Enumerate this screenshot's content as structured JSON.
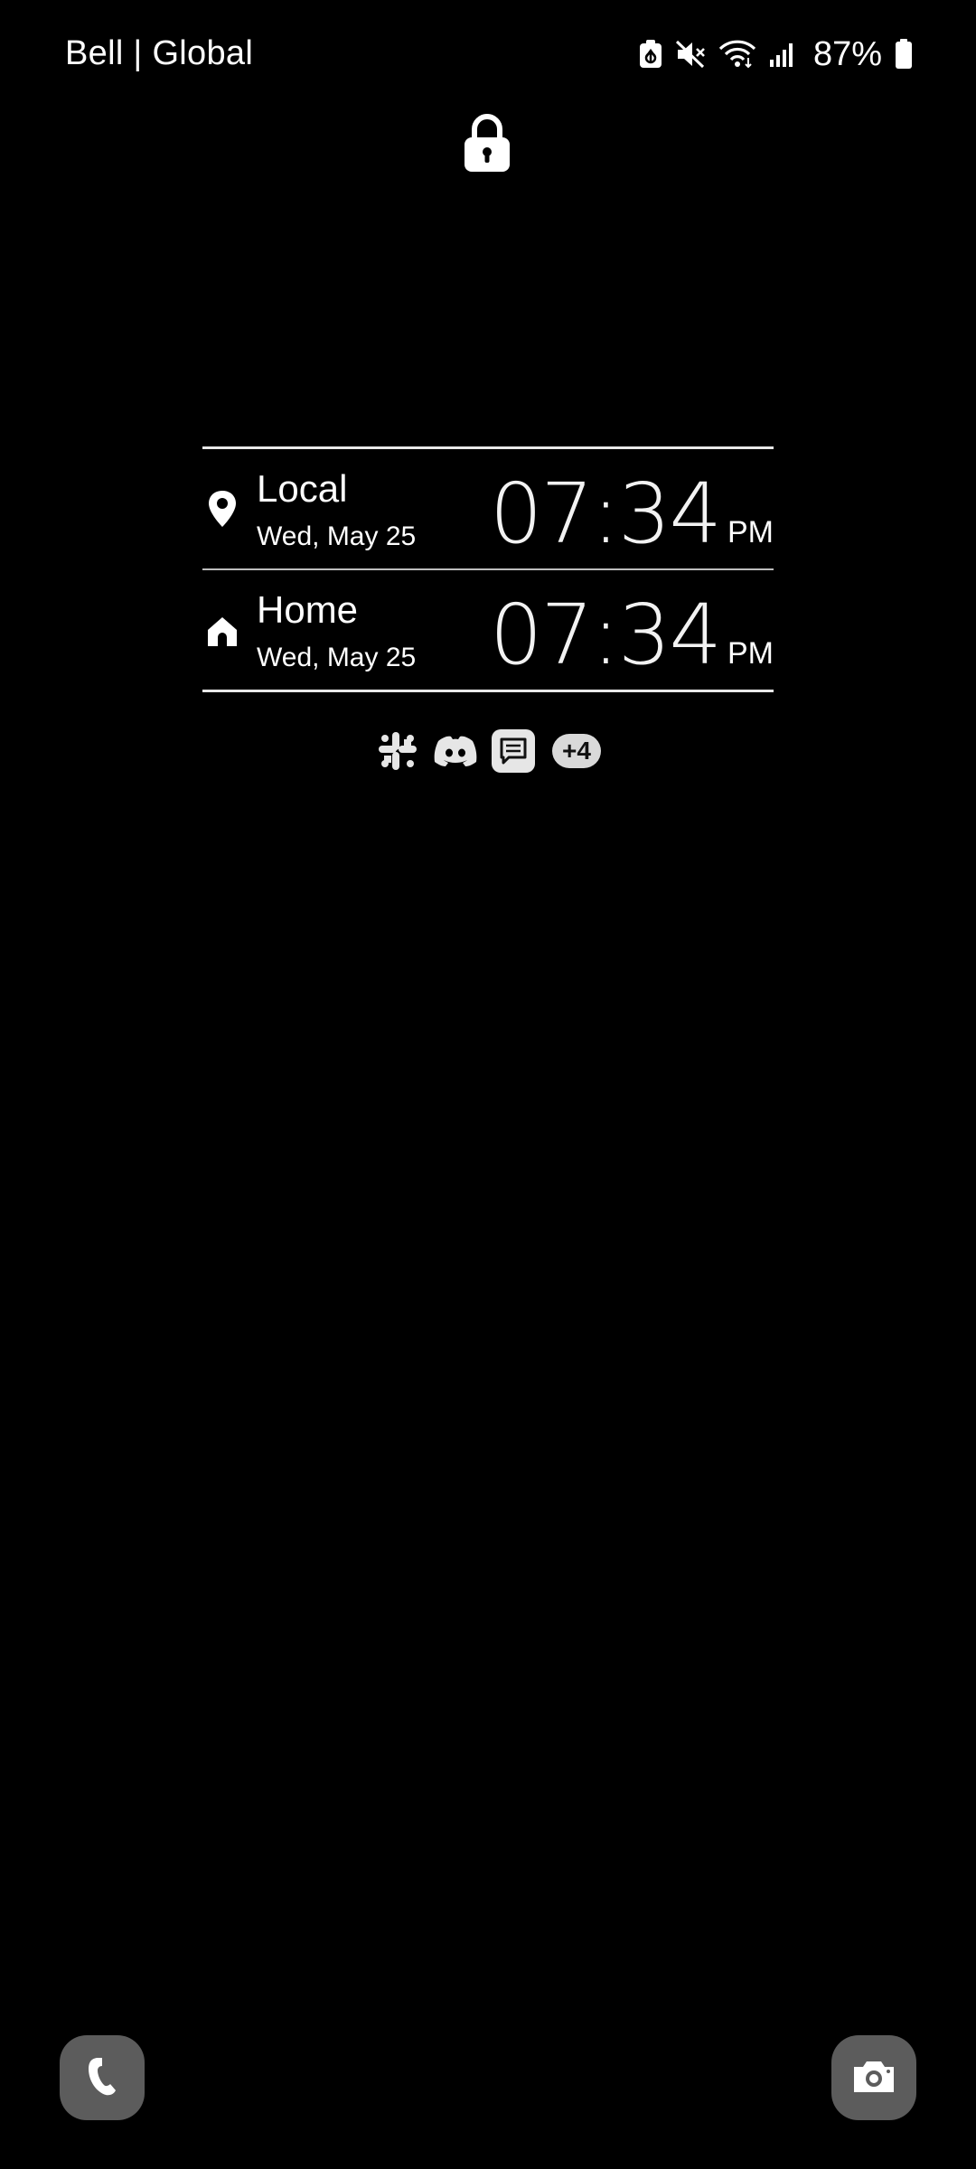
{
  "status_bar": {
    "carrier": "Bell | Global",
    "battery_percent": "87%",
    "icons": [
      "battery-saver-icon",
      "mute-icon",
      "wifi-icon",
      "signal-icon",
      "battery-icon"
    ]
  },
  "lock_screen": {
    "lock_icon": "lock-icon"
  },
  "dual_clock": {
    "rows": [
      {
        "icon": "location-pin-icon",
        "city": "Local",
        "date": "Wed, May 25",
        "time": "07:34",
        "ampm": "PM"
      },
      {
        "icon": "home-icon",
        "city": "Home",
        "date": "Wed, May 25",
        "time": "07:34",
        "ampm": "PM"
      }
    ]
  },
  "notifications": {
    "icons": [
      "slack-icon",
      "discord-icon",
      "messages-icon"
    ],
    "more_count": "+4"
  },
  "shortcuts": {
    "left": "phone-icon",
    "right": "camera-icon"
  }
}
